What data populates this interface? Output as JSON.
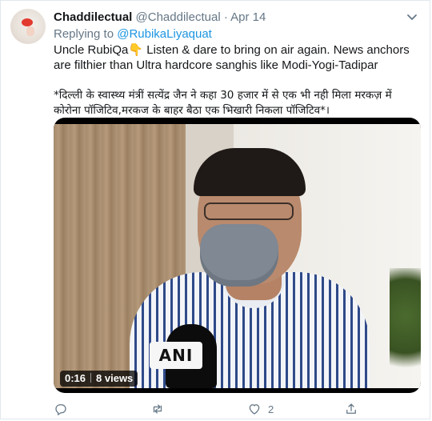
{
  "tweet": {
    "author_name": "Chaddilectual",
    "author_handle": "@Chaddilectual",
    "dot": "·",
    "date": "Apr 14",
    "replying_prefix": "Replying to",
    "replying_to": "@RubikaLiyaquat",
    "text_line1": "Uncle RubiQa👇 Listen & dare to bring on air again. News anchors are filthier than Ultra hardcore sanghis like Modi-Yogi-Tadipar",
    "text_hindi": "*दिल्ली के स्वास्थ्य मंत्रीं सत्येंद्र जैन ने कहा 30 हजार में से एक भी नही मिला मरकज़ में कोरोना पॉजिटिव,मरकज के बाहर बैठा एक भिखारी निकला पॉजिटिव*।"
  },
  "video": {
    "duration": "0:16",
    "views": "8 views",
    "mic_logo": "ANI"
  },
  "actions": {
    "reply_count": "",
    "retweet_count": "",
    "like_count": "2",
    "share_count": ""
  }
}
